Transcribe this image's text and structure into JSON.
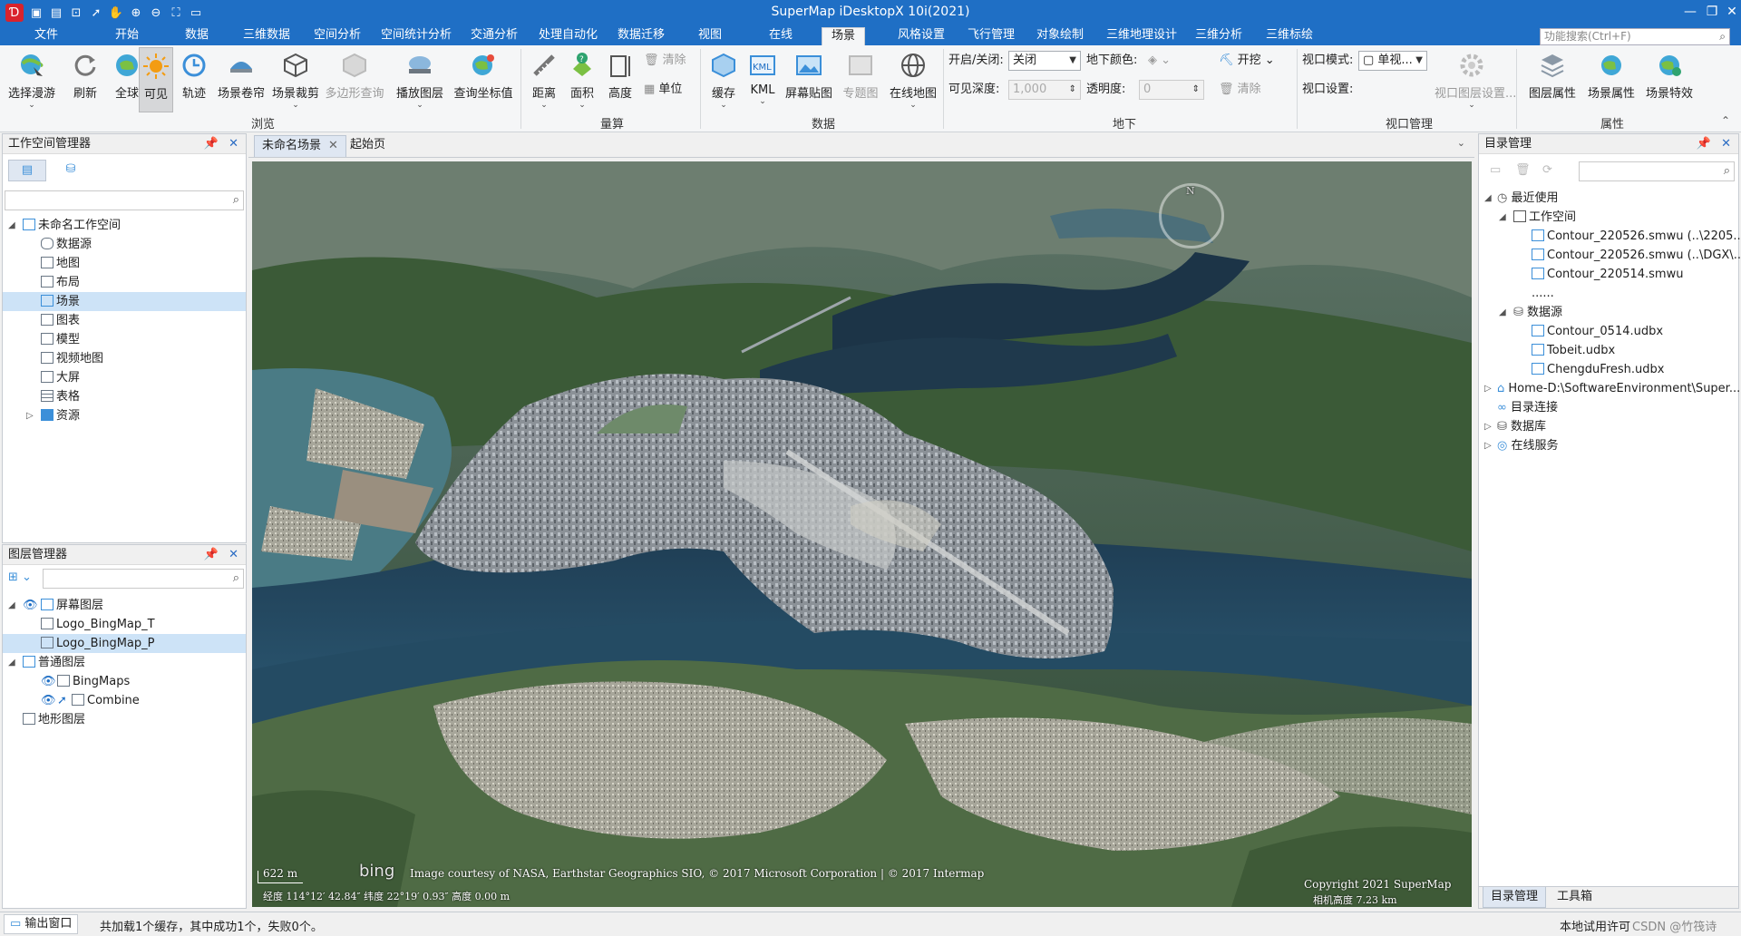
{
  "app": {
    "title": "SuperMap iDesktopX 10i(2021)"
  },
  "colors": {
    "brand": "#1f6fc5",
    "selection": "#cde3f7",
    "ribbon": "#f5f6f7"
  },
  "quick_access": [
    "logo-icon",
    "save-icon",
    "open-icon",
    "select-icon",
    "pan-icon",
    "zoom-in-icon",
    "zoom-out-icon",
    "full-extent-icon",
    "folder-icon"
  ],
  "tabs": [
    "文件",
    "开始",
    "数据",
    "三维数据",
    "空间分析",
    "空间统计分析",
    "交通分析",
    "处理自动化",
    "数据迁移",
    "视图",
    "在线",
    "场景",
    "风格设置",
    "飞行管理",
    "对象绘制",
    "三维地理设计",
    "三维分析",
    "三维标绘"
  ],
  "active_tab": "场景",
  "func_search": "功能搜索(Ctrl+F)",
  "ribbon": {
    "browse": {
      "group": "浏览",
      "buttons": [
        "选择漫游",
        "刷新",
        "全球",
        "可见",
        "轨迹",
        "场景卷帘",
        "场景裁剪",
        "多边形查询",
        "播放图层",
        "查询坐标值"
      ]
    },
    "measure": {
      "group": "量算",
      "buttons": [
        "距离",
        "面积",
        "高度"
      ],
      "small": [
        "清除",
        "单位"
      ]
    },
    "data": {
      "group": "数据",
      "buttons": [
        "缓存",
        "KML",
        "屏幕贴图",
        "专题图",
        "在线地图"
      ]
    },
    "underground": {
      "group": "地下",
      "onoff_label": "开启/关闭:",
      "onoff_value": "关闭",
      "color_label": "地下颜色:",
      "depth_label": "可见深度:",
      "depth_value": "1,000",
      "opacity_label": "透明度:",
      "opacity_value": "0",
      "excavate": "开挖",
      "clear": "清除"
    },
    "viewport": {
      "group": "视口管理",
      "mode_label": "视口模式:",
      "mode_value": "单视...",
      "setting_label": "视口设置:",
      "layer_setting": "视口图层设置..."
    },
    "attributes": {
      "group": "属性",
      "buttons": [
        "图层属性",
        "场景属性",
        "场景特效"
      ]
    }
  },
  "workspace": {
    "title": "工作空间管理器",
    "root": "未命名工作空间",
    "items": [
      "数据源",
      "地图",
      "布局",
      "场景",
      "图表",
      "模型",
      "视频地图",
      "大屏",
      "表格",
      "资源"
    ],
    "selected": "场景"
  },
  "layers": {
    "title": "图层管理器",
    "screen_group": "屏幕图层",
    "screen_items": [
      "Logo_BingMap_T",
      "Logo_BingMap_P"
    ],
    "normal_group": "普通图层",
    "normal_items": [
      "BingMaps",
      "Combine"
    ],
    "terrain_group": "地形图层"
  },
  "doc_tabs": [
    "未命名场景",
    "起始页"
  ],
  "scene": {
    "scale": "622 m",
    "attribution": "Image courtesy of NASA, Earthstar Geographics SIO, © 2017 Microsoft Corporation | © 2017 Intermap",
    "copyright": "Copyright 2021 SuperMap",
    "coords": "经度 114°12′   42.84″  纬度 22°19′   0.93″   高度 0.00 m",
    "camera": "相机高度 7.23 km",
    "bing": "bing",
    "compass": "N"
  },
  "catalog": {
    "title": "目录管理",
    "recent": "最近使用",
    "workspace": "工作空间",
    "ws_items": [
      "Contour_220526.smwu (..\\2205...",
      "Contour_220526.smwu (..\\DGX\\..)",
      "Contour_220514.smwu",
      "......"
    ],
    "datasource": "数据源",
    "ds_items": [
      "Contour_0514.udbx",
      "Tobeit.udbx",
      "ChengduFresh.udbx"
    ],
    "home": "Home-D:\\SoftwareEnvironment\\Super...",
    "catalog_conn": "目录连接",
    "database": "数据库",
    "online": "在线服务",
    "bottom_tabs": [
      "目录管理",
      "工具箱"
    ]
  },
  "status": {
    "output": "输出窗口",
    "message": "共加载1个缓存，其中成功1个，失败0个。",
    "trial": "本地试用许可",
    "extra": "CSDN @竹筏诗"
  }
}
